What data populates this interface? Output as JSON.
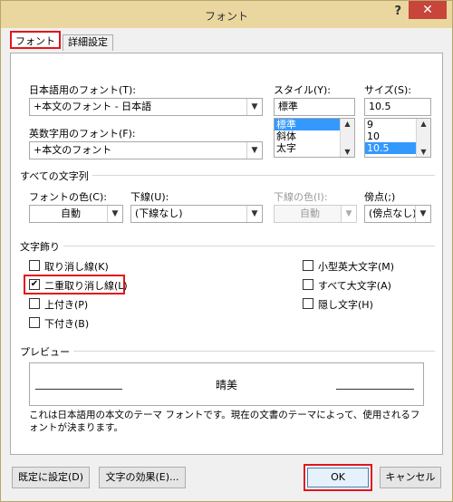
{
  "window": {
    "title": "フォント",
    "help_label": "?",
    "close_label": "✕"
  },
  "tabs": [
    {
      "label": "フォント"
    },
    {
      "label": "詳細設定"
    }
  ],
  "font": {
    "japanese_label": "日本語用のフォント(T):",
    "japanese_value": "+本文のフォント - 日本語",
    "western_label": "英数字用のフォント(F):",
    "western_value": "+本文のフォント"
  },
  "style": {
    "label": "スタイル(Y):",
    "value": "標準",
    "options": [
      "標準",
      "斜体",
      "太字"
    ],
    "selected_index": 0
  },
  "size": {
    "label": "サイズ(S):",
    "value": "10.5",
    "options": [
      "9",
      "10",
      "10.5"
    ],
    "selected_index": 2
  },
  "all_text": {
    "group_title": "すべての文字列",
    "font_color_label": "フォントの色(C):",
    "font_color_value": "自動",
    "underline_label": "下線(U):",
    "underline_value": "(下線なし)",
    "underline_color_label": "下線の色(I):",
    "underline_color_value": "自動",
    "emphasis_label": "傍点(;)",
    "emphasis_value": "(傍点なし)"
  },
  "effects": {
    "group_title": "文字飾り",
    "left": [
      {
        "label": "取り消し線(K)",
        "checked": false
      },
      {
        "label": "二重取り消し線(L)",
        "checked": true
      },
      {
        "label": "上付き(P)",
        "checked": false
      },
      {
        "label": "下付き(B)",
        "checked": false
      }
    ],
    "right": [
      {
        "label": "小型英大文字(M)",
        "checked": false
      },
      {
        "label": "すべて大文字(A)",
        "checked": false
      },
      {
        "label": "隠し文字(H)",
        "checked": false
      }
    ]
  },
  "preview": {
    "group_title": "プレビュー",
    "sample_text": "晴美",
    "description": "これは日本語用の本文のテーマ フォントです。現在の文書のテーマによって、使用されるフォントが決まります。"
  },
  "buttons": {
    "set_default": "既定に設定(D)",
    "text_effects": "文字の効果(E)...",
    "ok": "OK",
    "cancel": "キャンセル"
  },
  "icons": {
    "dropdown": "▼",
    "checkmark": "✔",
    "scroll_up": "▲",
    "scroll_down": "▼"
  }
}
